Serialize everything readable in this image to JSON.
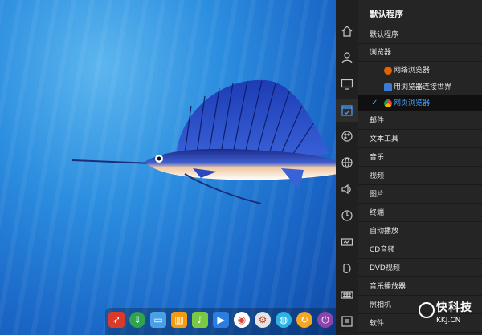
{
  "panel": {
    "title": "默认程序",
    "categories": [
      "默认程序",
      "浏览器",
      "邮件",
      "文本工具",
      "音乐",
      "视频",
      "图片",
      "终端",
      "自动播放",
      "CD音频",
      "DVD视频",
      "音乐播放器",
      "照相机",
      "软件"
    ],
    "browsers": [
      {
        "label": "网络浏览器",
        "icon": "firefox-icon",
        "color": "#e66000"
      },
      {
        "label": "用浏览器连接世界",
        "icon": "browser-window-icon",
        "color": "#3a7bd5"
      },
      {
        "label": "网页浏览器",
        "icon": "chrome-icon",
        "color": "#34a853",
        "selected": true
      }
    ]
  },
  "watermark": {
    "title": "快科技",
    "url": "KKJ.CN"
  },
  "sidebar_icons": [
    "home-icon",
    "user-icon",
    "display-icon",
    "default-app-icon",
    "personalization-icon",
    "network-icon",
    "sound-icon",
    "time-icon",
    "power-icon",
    "mouse-icon",
    "keyboard-icon",
    "system-info-icon"
  ],
  "colors": {
    "accent": "#4aa3ff",
    "panel": "#252525",
    "iconbar": "#202020"
  }
}
